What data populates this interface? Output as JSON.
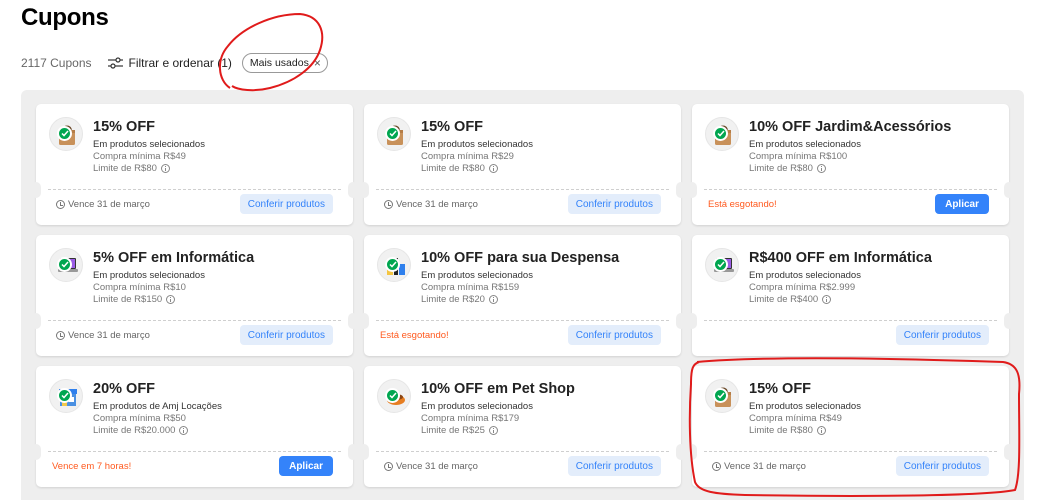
{
  "page": {
    "title": "Cupons"
  },
  "toolbar": {
    "count": "2117 Cupons",
    "filter_label": "Filtrar e ordenar (1)",
    "chip_label": "Mais usados"
  },
  "colors": {
    "accent": "#3483fa",
    "success": "#00a650",
    "warning": "#ff5a1f",
    "annotation": "#e01b1b"
  },
  "cards": [
    {
      "title": "15% OFF",
      "subtitle": "Em produtos selecionados",
      "min": "Compra mínima R$49",
      "limit": "Limite de R$80",
      "footer": "Vence 31 de março",
      "footer_warn": false,
      "button": "Conferir produtos",
      "button_primary": false,
      "icon": "shopping-bag-icon"
    },
    {
      "title": "15% OFF",
      "subtitle": "Em produtos selecionados",
      "min": "Compra mínima R$29",
      "limit": "Limite de R$80",
      "footer": "Vence 31 de março",
      "footer_warn": false,
      "button": "Conferir produtos",
      "button_primary": false,
      "icon": "shopping-bag-icon"
    },
    {
      "title": "10% OFF Jardim&Acessórios",
      "subtitle": "Em produtos selecionados",
      "min": "Compra mínima R$100",
      "limit": "Limite de R$80",
      "footer": "Está esgotando!",
      "footer_warn": true,
      "button": "Aplicar",
      "button_primary": true,
      "icon": "shopping-bag-icon"
    },
    {
      "title": "5% OFF em Informática",
      "subtitle": "Em produtos selecionados",
      "min": "Compra mínima R$10",
      "limit": "Limite de R$150",
      "footer": "Vence 31 de março",
      "footer_warn": false,
      "button": "Conferir produtos",
      "button_primary": false,
      "icon": "laptop-icon"
    },
    {
      "title": "10% OFF para sua Despensa",
      "subtitle": "Em produtos selecionados",
      "min": "Compra mínima R$159",
      "limit": "Limite de R$20",
      "footer": "Está esgotando!",
      "footer_warn": true,
      "button": "Conferir produtos",
      "button_primary": false,
      "icon": "groceries-icon"
    },
    {
      "title": "R$400 OFF em Informática",
      "subtitle": "Em produtos selecionados",
      "min": "Compra mínima R$2.999",
      "limit": "Limite de R$400",
      "footer": "",
      "footer_warn": false,
      "button": "Conferir produtos",
      "button_primary": false,
      "icon": "laptop-icon"
    },
    {
      "title": "20% OFF",
      "subtitle": "Em produtos de Amj Locações",
      "min": "Compra mínima R$50",
      "limit": "Limite de R$20.000",
      "footer": "Vence em 7 horas!",
      "footer_warn": true,
      "button": "Aplicar",
      "button_primary": true,
      "icon": "store-icon"
    },
    {
      "title": "10% OFF em Pet Shop",
      "subtitle": "Em produtos selecionados",
      "min": "Compra mínima R$179",
      "limit": "Limite de R$25",
      "footer": "Vence 31 de março",
      "footer_warn": false,
      "button": "Conferir produtos",
      "button_primary": false,
      "icon": "pet-bowl-icon"
    },
    {
      "title": "15% OFF",
      "subtitle": "Em produtos selecionados",
      "min": "Compra mínima R$49",
      "limit": "Limite de R$80",
      "footer": "Vence 31 de março",
      "footer_warn": false,
      "button": "Conferir produtos",
      "button_primary": false,
      "icon": "shopping-bag-icon"
    }
  ]
}
